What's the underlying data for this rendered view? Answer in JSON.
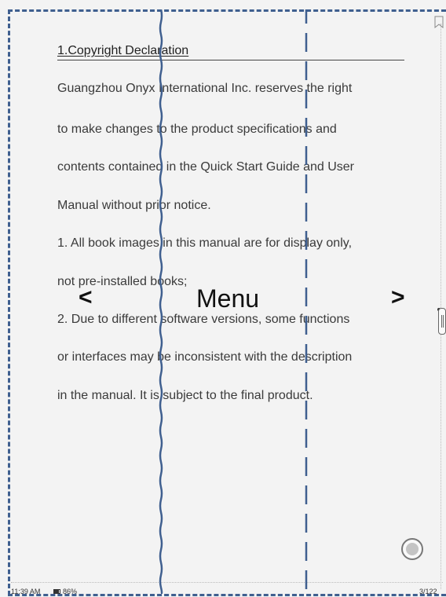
{
  "document": {
    "heading": "1.Copyright Declaration",
    "lines": [
      "Guangzhou Onyx International Inc. reserves the right",
      "to make changes to the product specifications and",
      "contents contained in the Quick Start Guide and User",
      "Manual without prior notice.",
      "1. All book images in this manual are for display only,",
      "not pre-installed books;",
      "2. Due to different software versions, some functions",
      "or interfaces may be inconsistent with the description",
      "in the manual. It is subject to the final product."
    ]
  },
  "overlay": {
    "prev_label": "<",
    "menu_label": "Menu",
    "next_label": ">",
    "style": "dashed-zone-guide",
    "accent_color": "#3f5f8f"
  },
  "status_bar": {
    "time": "11:39 AM",
    "battery": "86%",
    "page": "3/122"
  },
  "icons": {
    "bookmark": "bookmark-icon",
    "battery": "battery-icon",
    "scroll": "scroll-handle",
    "float": "floating-action-button"
  }
}
